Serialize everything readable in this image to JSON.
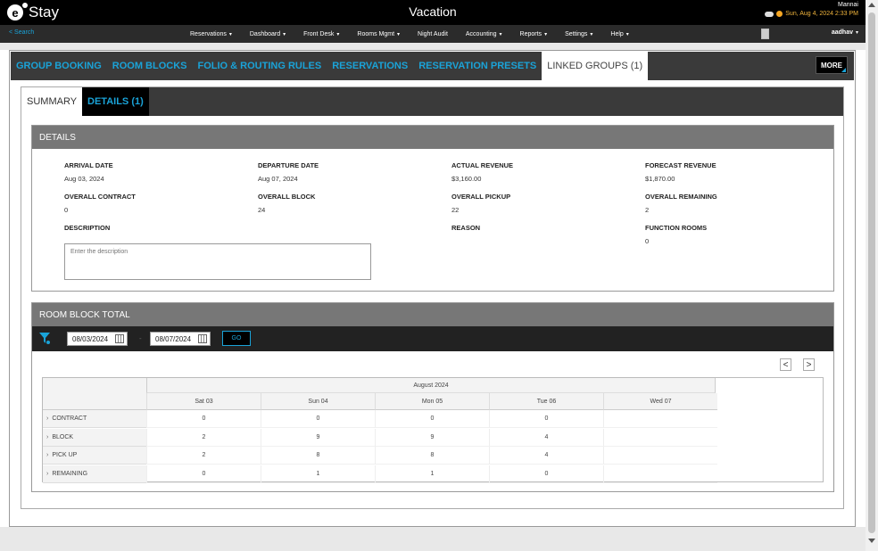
{
  "app": {
    "logo_letter": "e",
    "logo_text": "Stay",
    "title": "Vacation"
  },
  "user": {
    "name": "Mannai",
    "datetime": "Sun, Aug 4, 2024 2:33 PM",
    "menu_user": "aadhav"
  },
  "menubar": {
    "search": "< Search",
    "items": [
      "Reservations",
      "Dashboard",
      "Front Desk",
      "Rooms Mgmt",
      "Night Audit",
      "Accounting",
      "Reports",
      "Settings",
      "Help"
    ],
    "has_caret": [
      true,
      true,
      true,
      true,
      false,
      true,
      true,
      true,
      true
    ]
  },
  "tabs": [
    "GROUP BOOKING",
    "ROOM BLOCKS",
    "FOLIO & ROUTING RULES",
    "RESERVATIONS",
    "RESERVATION PRESETS",
    "LINKED GROUPS (1)"
  ],
  "more_label": "MORE",
  "subtabs": [
    "SUMMARY",
    "DETAILS (1)"
  ],
  "details": {
    "heading": "DETAILS",
    "arrival_label": "ARRIVAL DATE",
    "arrival_value": "Aug 03, 2024",
    "departure_label": "DEPARTURE DATE",
    "departure_value": "Aug 07, 2024",
    "actual_rev_label": "ACTUAL REVENUE",
    "actual_rev_value": "$3,160.00",
    "forecast_rev_label": "FORECAST REVENUE",
    "forecast_rev_value": "$1,870.00",
    "contract_label": "OVERALL CONTRACT",
    "contract_value": "0",
    "block_label": "OVERALL BLOCK",
    "block_value": "24",
    "pickup_label": "OVERALL PICKUP",
    "pickup_value": "22",
    "remaining_label": "OVERALL REMAINING",
    "remaining_value": "2",
    "description_label": "DESCRIPTION",
    "description_placeholder": "Enter the description",
    "reason_label": "REASON",
    "function_rooms_label": "FUNCTION ROOMS",
    "function_rooms_value": "0"
  },
  "room_block": {
    "heading": "ROOM BLOCK TOTAL",
    "from_date": "08/03/2024",
    "dash": "-",
    "to_date": "08/07/2024",
    "go_label": "GO",
    "prev": "<",
    "next": ">",
    "month": "August 2024",
    "days": [
      "Sat 03",
      "Sun 04",
      "Mon 05",
      "Tue 06",
      "Wed 07"
    ],
    "rows": [
      {
        "label": "CONTRACT",
        "values": [
          "0",
          "0",
          "0",
          "0",
          ""
        ]
      },
      {
        "label": "BLOCK",
        "values": [
          "2",
          "9",
          "9",
          "4",
          ""
        ]
      },
      {
        "label": "PICK UP",
        "values": [
          "2",
          "8",
          "8",
          "4",
          ""
        ]
      },
      {
        "label": "REMAINING",
        "values": [
          "0",
          "1",
          "1",
          "0",
          ""
        ]
      }
    ]
  }
}
